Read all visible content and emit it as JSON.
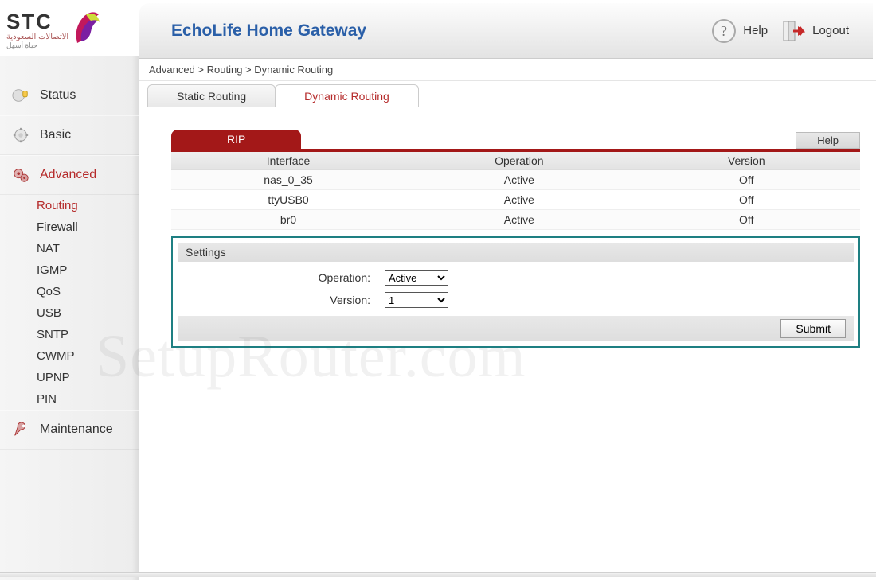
{
  "logo": {
    "brand": "STC",
    "sub1": "الاتصالات السعودية",
    "sub2": "حياة أسهل"
  },
  "header": {
    "title": "EchoLife Home Gateway",
    "help_label": "Help",
    "logout_label": "Logout"
  },
  "breadcrumb": "Advanced > Routing > Dynamic Routing",
  "tabs": {
    "static": "Static Routing",
    "dynamic": "Dynamic Routing"
  },
  "sidebar": {
    "status": "Status",
    "basic": "Basic",
    "advanced": "Advanced",
    "maintenance": "Maintenance",
    "sub": {
      "routing": "Routing",
      "firewall": "Firewall",
      "nat": "NAT",
      "igmp": "IGMP",
      "qos": "QoS",
      "usb": "USB",
      "sntp": "SNTP",
      "cwmp": "CWMP",
      "upnp": "UPNP",
      "pin": "PIN"
    }
  },
  "section": {
    "tab_label": "RIP",
    "help_label": "Help"
  },
  "table": {
    "headers": {
      "interface": "Interface",
      "operation": "Operation",
      "version": "Version"
    },
    "rows": [
      {
        "interface": "nas_0_35",
        "operation": "Active",
        "version": "Off"
      },
      {
        "interface": "ttyUSB0",
        "operation": "Active",
        "version": "Off"
      },
      {
        "interface": "br0",
        "operation": "Active",
        "version": "Off"
      }
    ]
  },
  "settings": {
    "title": "Settings",
    "operation_label": "Operation:",
    "operation_value": "Active",
    "version_label": "Version:",
    "version_value": "1",
    "submit_label": "Submit"
  },
  "watermark": "SetupRouter.com"
}
